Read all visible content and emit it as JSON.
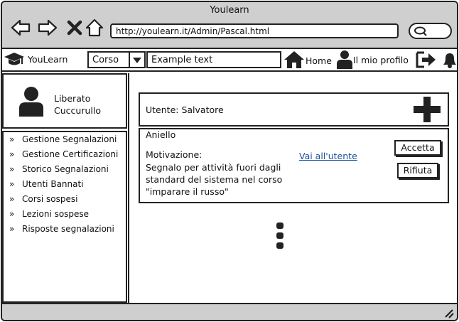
{
  "window": {
    "title": "Youlearn"
  },
  "browser": {
    "url": "http://youlearn.it/Admin/Pascal.html"
  },
  "menubar": {
    "brand": "YouLearn",
    "select_value": "Corso",
    "search_text": "Example text",
    "home_label": "Home",
    "profile_label": "Il mio profilo"
  },
  "user_box": {
    "name_line1": "Liberato",
    "name_line2": "Cuccurullo"
  },
  "sidebar": {
    "items": [
      {
        "label": "Gestione Segnalazioni"
      },
      {
        "label": "Gestione Certificazioni"
      },
      {
        "label": "Storico Segnalazioni"
      },
      {
        "label": "Utenti Bannati"
      },
      {
        "label": "Corsi sospesi"
      },
      {
        "label": "Lezioni sospese"
      },
      {
        "label": "Risposte segnalazioni"
      }
    ]
  },
  "main": {
    "user_card": {
      "label": "Utente: Salvatore"
    },
    "report": {
      "reporter": "Aniello",
      "motivation_label": "Motivazione:",
      "motivation_line1": "Segnalo per attività fuori dagli",
      "motivation_line2": "standard del sistema nel corso",
      "motivation_line3": "\"imparare il russo\"",
      "link_label": "Vai all'utente",
      "accept_label": "Accetta",
      "reject_label": "Rifiuta"
    }
  },
  "icons": {
    "back": "arrow-left-icon",
    "forward": "arrow-right-icon",
    "stop": "close-icon",
    "home_nav": "home-icon",
    "brand": "graduation-cap-icon",
    "user": "user-icon",
    "logout": "logout-icon",
    "notifications": "bell-icon",
    "add": "plus-icon",
    "more": "vertical-dots-icon",
    "resize": "resize-grip-icon"
  }
}
